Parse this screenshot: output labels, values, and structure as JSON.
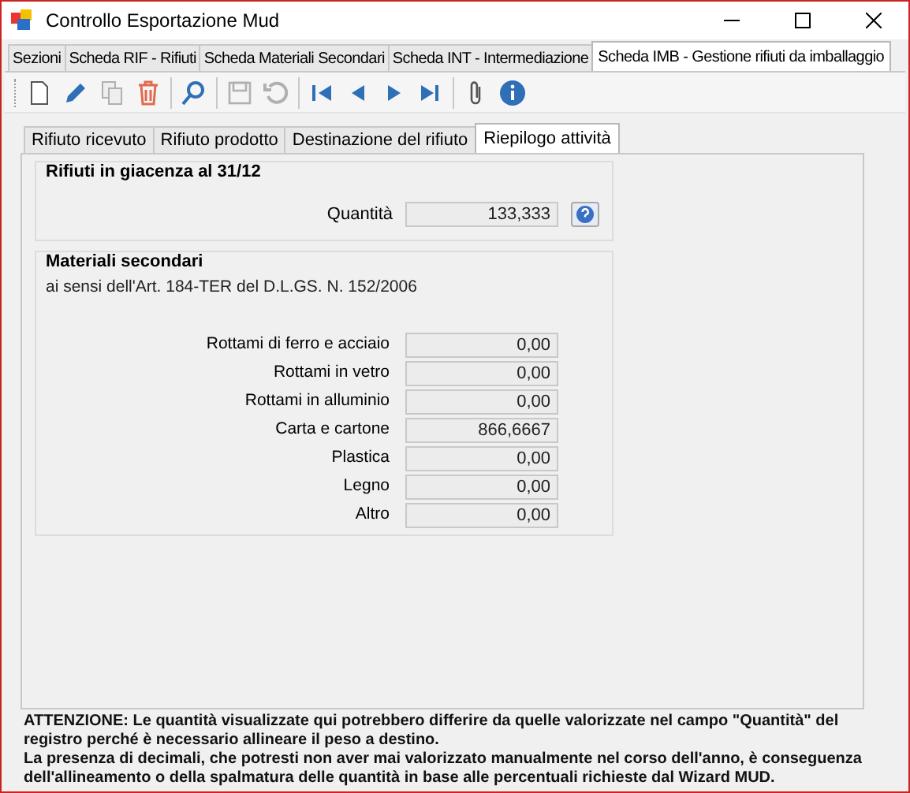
{
  "window": {
    "title": "Controllo Esportazione Mud"
  },
  "tabs": [
    {
      "label": "Sezioni",
      "selected": false
    },
    {
      "label": "Scheda RIF - Rifiuti",
      "selected": false
    },
    {
      "label": "Scheda Materiali Secondari",
      "selected": false
    },
    {
      "label": "Scheda INT - Intermediazione",
      "selected": false
    },
    {
      "label": "Scheda IMB - Gestione rifiuti da imballaggio",
      "selected": true
    }
  ],
  "toolbar": [
    {
      "kind": "new",
      "disabled": false
    },
    {
      "kind": "edit",
      "disabled": false
    },
    {
      "kind": "copy",
      "disabled": true
    },
    {
      "kind": "delete",
      "disabled": false
    },
    {
      "kind": "sep"
    },
    {
      "kind": "search",
      "disabled": false
    },
    {
      "kind": "sep"
    },
    {
      "kind": "save",
      "disabled": true
    },
    {
      "kind": "undo",
      "disabled": true
    },
    {
      "kind": "sep"
    },
    {
      "kind": "first",
      "disabled": false
    },
    {
      "kind": "prev",
      "disabled": false
    },
    {
      "kind": "next",
      "disabled": false
    },
    {
      "kind": "last",
      "disabled": false
    },
    {
      "kind": "sep"
    },
    {
      "kind": "attach",
      "disabled": false
    },
    {
      "kind": "info",
      "disabled": false
    }
  ],
  "subtabs": [
    {
      "label": "Rifiuto ricevuto",
      "selected": false
    },
    {
      "label": "Rifiuto prodotto",
      "selected": false
    },
    {
      "label": "Destinazione del rifiuto",
      "selected": false
    },
    {
      "label": "Riepilogo attività",
      "selected": true
    }
  ],
  "stock": {
    "title": "Rifiuti in giacenza al 31/12",
    "label": "Quantità",
    "value": "133,333"
  },
  "secondary": {
    "title": "Materiali secondari",
    "subtitle": "ai sensi dell'Art. 184-TER del D.L.GS. N. 152/2006",
    "rows": [
      {
        "label": "Rottami di ferro e acciaio",
        "value": "0,00"
      },
      {
        "label": "Rottami in vetro",
        "value": "0,00"
      },
      {
        "label": "Rottami in alluminio",
        "value": "0,00"
      },
      {
        "label": "Carta e cartone",
        "value": "866,6667"
      },
      {
        "label": "Plastica",
        "value": "0,00"
      },
      {
        "label": "Legno",
        "value": "0,00"
      },
      {
        "label": "Altro",
        "value": "0,00"
      }
    ]
  },
  "warning": [
    "ATTENZIONE: Le quantità visualizzate qui potrebbero differire da quelle valorizzate nel campo \"Quantità\" del registro perché è necessario allineare il peso a destino.",
    "La presenza di decimali, che potresti non aver mai valorizzato manualmente nel corso dell'anno, è conseguenza dell'allineamento o della spalmatura delle quantità in base alle percentuali richieste dal Wizard MUD."
  ]
}
